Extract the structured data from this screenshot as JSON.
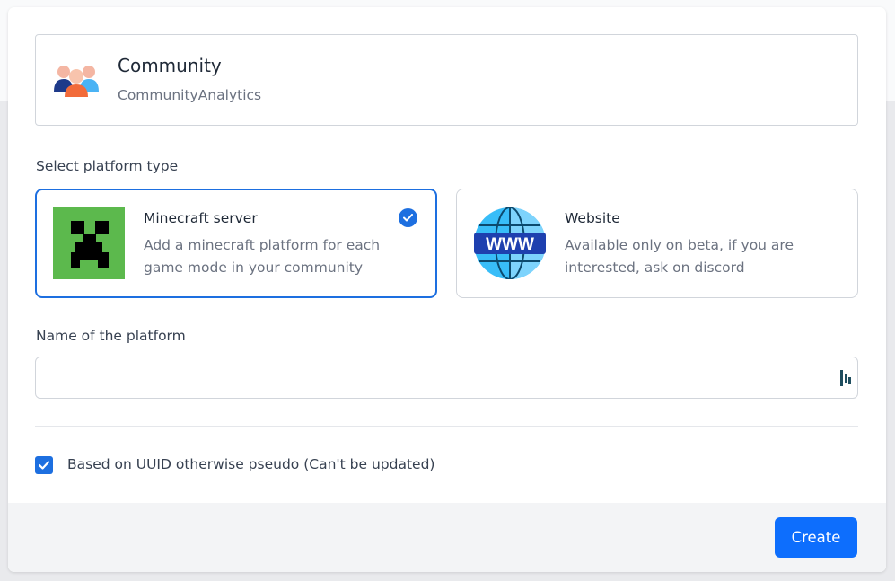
{
  "community": {
    "title": "Community",
    "subtitle": "CommunityAnalytics",
    "icon": "community-group-icon"
  },
  "platform_type": {
    "label": "Select platform type",
    "options": [
      {
        "title": "Minecraft server",
        "description": "Add a minecraft platform for each game mode in your community",
        "icon": "minecraft-creeper-icon",
        "selected": true
      },
      {
        "title": "Website",
        "description": "Available only on beta, if you are interested, ask on discord",
        "icon": "globe-www-icon",
        "selected": false
      }
    ]
  },
  "platform_name": {
    "label": "Name of the platform",
    "value": "",
    "placeholder": ""
  },
  "uuid_option": {
    "label": "Based on UUID otherwise pseudo (Can't be updated)",
    "checked": true
  },
  "footer": {
    "create_label": "Create"
  },
  "colors": {
    "accent": "#1d6fe0",
    "button": "#0d6efd",
    "minecraft_green": "#5cb94d"
  }
}
